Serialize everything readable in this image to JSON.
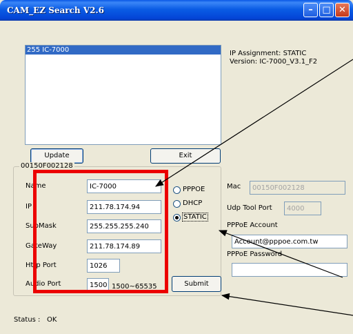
{
  "window": {
    "title": "CAM_EZ Search V2.6"
  },
  "device_list": {
    "items": [
      "255 IC-7000"
    ]
  },
  "info": {
    "ip_assignment": "IP Assignment:  STATIC",
    "version": "Version: IC-7000_V3.1_F2"
  },
  "buttons": {
    "update": "Update",
    "exit": "Exit",
    "submit": "Submit"
  },
  "group": {
    "label": "00150F002128"
  },
  "fields": {
    "name_label": "Name",
    "name_value": "IC-7000",
    "ip_label": "IP",
    "ip_value": "211.78.174.94",
    "submask_label": "SubMask",
    "submask_value": "255.255.255.240",
    "gateway_label": "GateWay",
    "gateway_value": "211.78.174.89",
    "http_port_label": "Http Port",
    "http_port_value": "1026",
    "audio_port_label": "Audio Port",
    "audio_port_value": "1500",
    "audio_port_range": "1500~65535"
  },
  "assignment": {
    "options": [
      "PPPOE",
      "DHCP",
      "STATIC"
    ],
    "selected": "STATIC"
  },
  "right_fields": {
    "mac_label": "Mac",
    "mac_value": "00150F002128",
    "udp_label": "Udp Tool Port",
    "udp_value": "4000",
    "pppoe_account_label": "PPPoE Account",
    "pppoe_account_value": "Account@pppoe.com.tw",
    "pppoe_password_label": "PPPoE Password",
    "pppoe_password_value": ""
  },
  "status": {
    "label": "Status :",
    "value": "OK"
  },
  "colors": {
    "annotation": "#ec0000",
    "selection": "#316ac5",
    "titlebar": "#0a5ce4"
  }
}
